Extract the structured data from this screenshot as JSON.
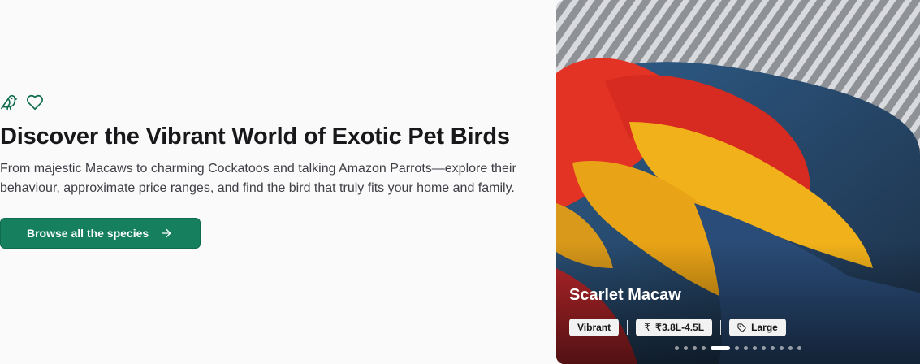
{
  "hero": {
    "icons": [
      "bird-icon",
      "heart-icon"
    ],
    "title": "Discover the Vibrant World of Exotic Pet Birds",
    "subtitle": "From majestic Macaws to charming Cockatoos and talking Amazon Parrots—explore their behaviour, approximate price ranges, and find the bird that truly fits your home and family.",
    "cta_label": "Browse all the species",
    "accent_color": "#16805e"
  },
  "carousel": {
    "bird_name": "Scarlet Macaw",
    "tags": {
      "temperament": "Vibrant",
      "price": "₹3.8L-4.5L",
      "size": "Large"
    },
    "slide_count": 13,
    "active_slide": 4
  }
}
